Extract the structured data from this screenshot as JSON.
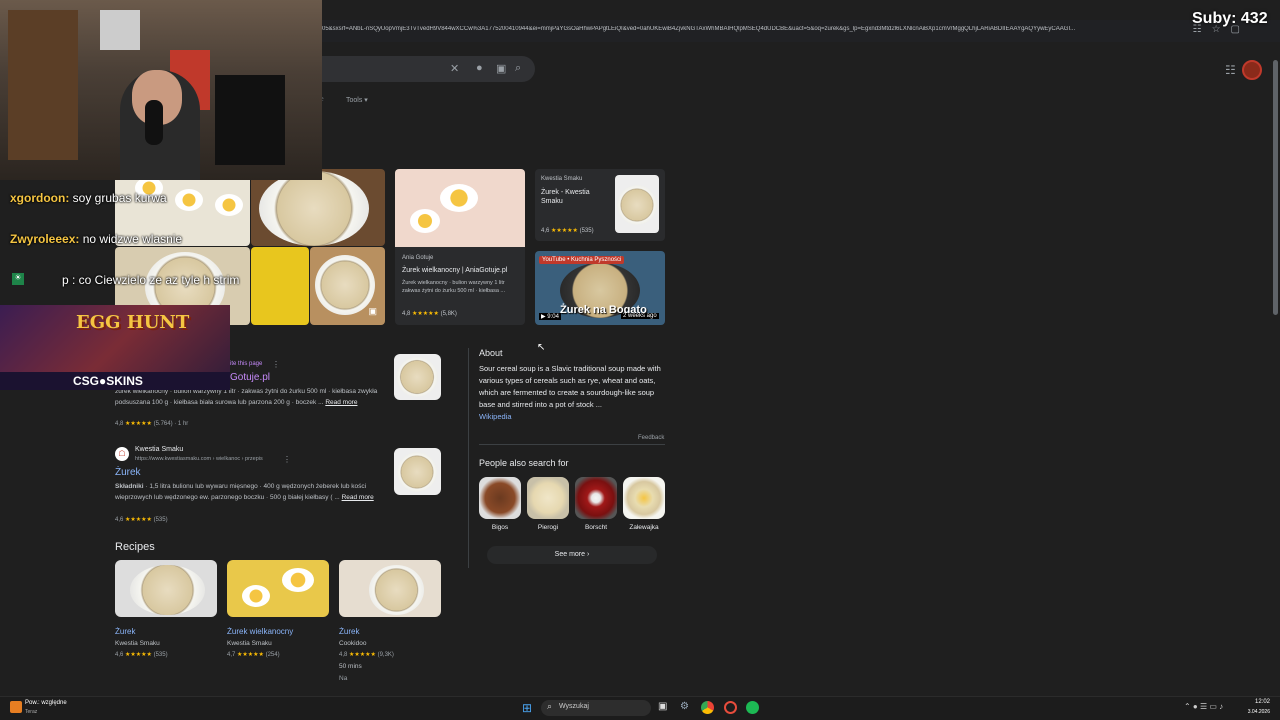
{
  "overlay": {
    "subs_label": "Suby: 432",
    "chat": [
      {
        "user": "xgordoon:",
        "color": "#f5c542",
        "message": "soy grubas kurwa"
      },
      {
        "user": "Zwyroleeex:",
        "color": "#f5c542",
        "message": "no widzwe wlasnie"
      },
      {
        "user": "",
        "color": "#ffffff",
        "message": "p : co Ciewzielo ze az tyle h strim"
      }
    ],
    "banner_title": "EGG HUNT",
    "banner_brand": "CSG●SKINS"
  },
  "browser": {
    "url": "05&sxsrf=ANbL-nSQyUopVmjE3TvTvedH9V844wXCCw%3A1775200410944&ei=mmjPaYGsOaHhwPAPgtLEiQI&ved=0ahUKEwiB4ZjvkNGTAxWhMBAIHQlpMSEQ4dUDCBE&uact=5&oq=zurek&gs_lp=Egxnd3Mtd2l6LXNlcnAiBXp1cmVrMggQLhjLARiABDIIEAAYgAQYywEyCAAGI...",
    "tools_label": "Tools",
    "faded_tab": "ne"
  },
  "image_results": [
    {
      "source": "Kwestia Smaku",
      "title": "Żurek - Kwestia Smaku",
      "rating": "4,6",
      "count": "(535)"
    },
    {
      "source": "Ania Gotuje",
      "title": "Żurek wielkanocny | AniaGotuje.pl",
      "snippet": "Żurek wielkanocny · bulion warzywny 1 litr zakwas żytni do żurku 500 ml · kiełbasa ...",
      "rating": "4,8",
      "count": "(5,8K)"
    },
    {
      "source": "YouTube • Kuchnia Pyszności",
      "video_title": "Żurek na Bogato",
      "duration": "9:04",
      "age": "2 weeks ago"
    }
  ],
  "results": [
    {
      "header_note": "ite this page",
      "title": "Gotuje.pl",
      "snippet": "żurek wielkanocny · bulion warzywny 1 litr · zakwas żytni do żurku 500 ml · kiełbasa zwykła podsuszana 100 g · kiełbasa biała surowa lub parzona 200 g · boczek ...",
      "read_more": "Read more",
      "rating": "4,8",
      "count": "(5.764) · 1 hr"
    },
    {
      "site": "Kwestia Smaku",
      "url": "https://www.kwestiasmaku.com › wielkanoc › przepis",
      "title": "Żurek",
      "snippet_bold": "Składniki",
      "snippet": " · 1,5 litra bulionu lub wywaru mięsnego · 400 g wędzonych żeberek lub kości wieprzowych lub wędzonego ew. parzonego boczku · 500 g białej kiełbasy ( ...",
      "read_more": "Read more",
      "rating": "4,6",
      "count": "(535)"
    }
  ],
  "about": {
    "heading": "About",
    "text": "Sour cereal soup is a Slavic traditional soup made with various types of cereals such as rye, wheat and oats, which are fermented to create a sourdough-like soup base and stirred into a pot of stock ...",
    "link": "Wikipedia",
    "feedback": "Feedback"
  },
  "people_also_search": {
    "heading": "People also search for",
    "items": [
      "Bigos",
      "Pierogi",
      "Borscht",
      "Załewajka"
    ],
    "see_more": "See more"
  },
  "recipes": {
    "heading": "Recipes",
    "items": [
      {
        "title": "Żurek",
        "source": "Kwestia Smaku",
        "rating": "4,6",
        "count": "(535)"
      },
      {
        "title": "Żurek wielkanocny",
        "source": "Kwestia Smaku",
        "rating": "4,7",
        "count": "(254)"
      },
      {
        "title": "Żurek",
        "source": "Cookidoo",
        "rating": "4,8",
        "count": "(9,3K)",
        "time": "50 mins",
        "extra": "Na"
      }
    ]
  },
  "taskbar": {
    "weather": "Pow.: względne",
    "weather_sub": "Teraz",
    "search_placeholder": "Wyszukaj",
    "time": "12:02",
    "date": "3.04.2026"
  },
  "colors": {
    "accent_link": "#8ab4f8",
    "star": "#fbbc04",
    "bg": "#1f1f1f"
  }
}
